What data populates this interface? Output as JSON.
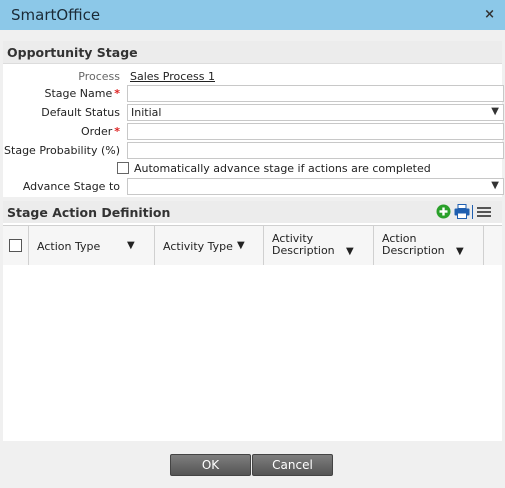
{
  "window": {
    "title": "SmartOffice",
    "close_glyph": "×"
  },
  "stage": {
    "heading": "Opportunity Stage",
    "process_label": "Process",
    "process_value": "Sales Process 1",
    "stage_name_label": "Stage Name",
    "stage_name_value": "",
    "default_status_label": "Default Status",
    "default_status_value": "Initial",
    "order_label": "Order",
    "order_value": "",
    "probability_label": "Stage Probability (%)",
    "probability_value": "",
    "auto_advance_label": "Automatically advance stage if actions are completed",
    "auto_advance_checked": false,
    "advance_to_label": "Advance Stage to",
    "advance_to_value": "",
    "required_mark": "*"
  },
  "actions": {
    "heading": "Stage Action Definition",
    "icons": [
      "add-icon",
      "print-icon",
      "menu-icon"
    ],
    "columns": [
      {
        "line1": "Action Type"
      },
      {
        "line1": "Activity Type"
      },
      {
        "line1": "Activity",
        "line2": "Description"
      },
      {
        "line1": "Action",
        "line2": "Description"
      }
    ],
    "rows": []
  },
  "buttons": {
    "ok": "OK",
    "cancel": "Cancel"
  },
  "colors": {
    "titlebar": "#8cc8e8",
    "required": "#dd2222",
    "add_icon": "#2aa02a",
    "print_icon": "#1f5fb0"
  }
}
